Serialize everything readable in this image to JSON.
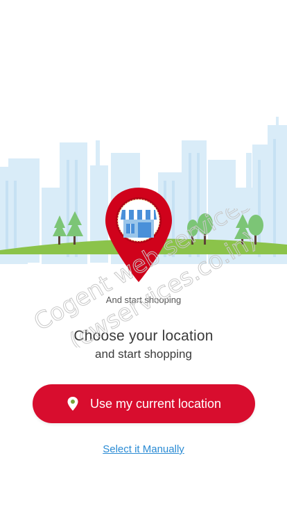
{
  "hero": {
    "caption": "And start shooping"
  },
  "heading": {
    "title": "Choose your location",
    "subtitle": "and start shopping"
  },
  "actions": {
    "use_location_label": "Use my current location",
    "select_manual_label": "Select it Manually"
  },
  "watermark": {
    "line1": "Cogent web services",
    "line2": "(cwservices.co.in)"
  },
  "icons": {
    "hero_pin": "store-location-pin-icon",
    "button_pin": "location-pin-icon"
  },
  "colors": {
    "brand_red": "#d80d2e",
    "link_blue": "#2a8bd4",
    "text_dark": "#3a3a3a",
    "skyline": "#d8ecf8",
    "grass": "#8bc34a"
  }
}
